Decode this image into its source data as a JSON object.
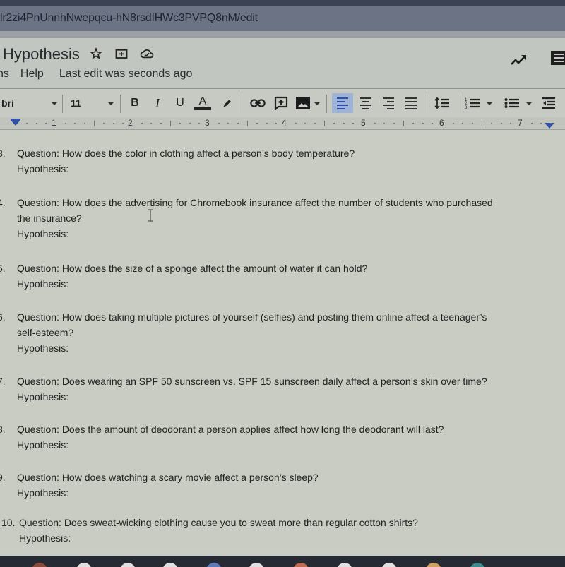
{
  "browser": {
    "url": "lr2zi4PnUnnhNwepqcu-hN8rsdIHWc3PVPQ8nM/edit"
  },
  "docs": {
    "title": "Hypothesis",
    "title_icons": [
      "star-icon",
      "move-to-folder-icon",
      "cloud-saved-icon"
    ],
    "menu": [
      {
        "label": "ns"
      },
      {
        "label": "Help"
      }
    ],
    "last_edit": "Last edit was seconds ago",
    "right_icons": [
      "activity-trend-icon",
      "comments-icon"
    ]
  },
  "toolbar": {
    "font_family": "bri",
    "font_size": "11",
    "bold_label": "B",
    "italic_label": "I",
    "underline_label": "U",
    "text_color_label": "A",
    "active_alignment": "left",
    "text_color": "#222222",
    "active_highlight_color": "#9fb3d6"
  },
  "ruler": {
    "numbers": [
      "1",
      "2",
      "3",
      "4",
      "5",
      "6",
      "7"
    ]
  },
  "document": {
    "questions": [
      {
        "num": "3.",
        "lines": [
          "Question:  How does the color in clothing affect a person’s body temperature?"
        ],
        "hypothesis": "Hypothesis:"
      },
      {
        "num": "4.",
        "lines": [
          "Question:  How does the advertising for Chromebook insurance affect the number of students who purchased",
          "the insurance?"
        ],
        "hypothesis": "Hypothesis:"
      },
      {
        "num": "5.",
        "lines": [
          "Question:  How does the size of a sponge affect the amount of water it can hold?"
        ],
        "hypothesis": "Hypothesis:"
      },
      {
        "num": "6.",
        "lines": [
          "Question: How does taking multiple pictures of yourself (selfies) and posting them online affect a teenager’s",
          "self-esteem?"
        ],
        "hypothesis": "Hypothesis:"
      },
      {
        "num": "7.",
        "lines": [
          "Question:  Does wearing an SPF 50 sunscreen vs. SPF 15 sunscreen daily affect a person’s skin over time?"
        ],
        "hypothesis": "Hypothesis:"
      },
      {
        "num": "8.",
        "lines": [
          "Question:   Does the amount of deodorant a person applies affect how long the deodorant will last?"
        ],
        "hypothesis": "Hypothesis:"
      },
      {
        "num": "9.",
        "lines": [
          "Question:  How does watching a scary movie affect a person’s sleep?"
        ],
        "hypothesis": "Hypothesis:"
      },
      {
        "num": "10.",
        "lines": [
          "Question:  Does sweat-wicking clothing cause you to sweat more than regular cotton shirts?"
        ],
        "hypothesis": "Hypothesis:"
      }
    ]
  }
}
